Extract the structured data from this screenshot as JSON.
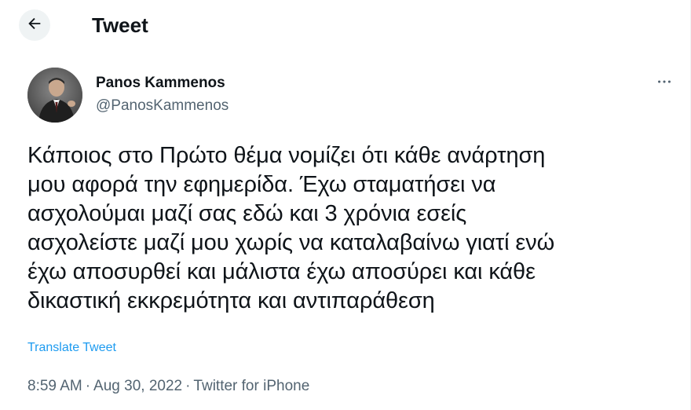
{
  "header": {
    "title": "Tweet",
    "back_icon": "arrow-left-icon"
  },
  "author": {
    "display_name": "Panos Kammenos",
    "handle": "@PanosKammenos",
    "avatar_icon": "avatar-photo",
    "more_icon": "more-horizontal-icon"
  },
  "tweet": {
    "text": "Κάποιος στο Πρώτο θέμα νομίζει ότι κάθε ανάρτηση\nμου αφορά την εφημερίδα. Έχω σταματήσει να\nασχολούμαι μαζί σας εδώ και 3 χρόνια εσείς\nασχολείστε μαζί μου χωρίς να καταλαβαίνω γιατί ενώ\nέχω αποσυρθεί και μάλιστα έχω αποσύρει και κάθε\nδικαστική εκκρεμότητα και αντιπαράθεση",
    "translate_label": "Translate Tweet",
    "time": "8:59 AM",
    "separator": "·",
    "date": "Aug 30, 2022",
    "source": "Twitter for iPhone"
  },
  "colors": {
    "text": "#0f1419",
    "secondary": "#536471",
    "accent": "#1d9bf0",
    "back_button_bg": "#eff3f4"
  }
}
